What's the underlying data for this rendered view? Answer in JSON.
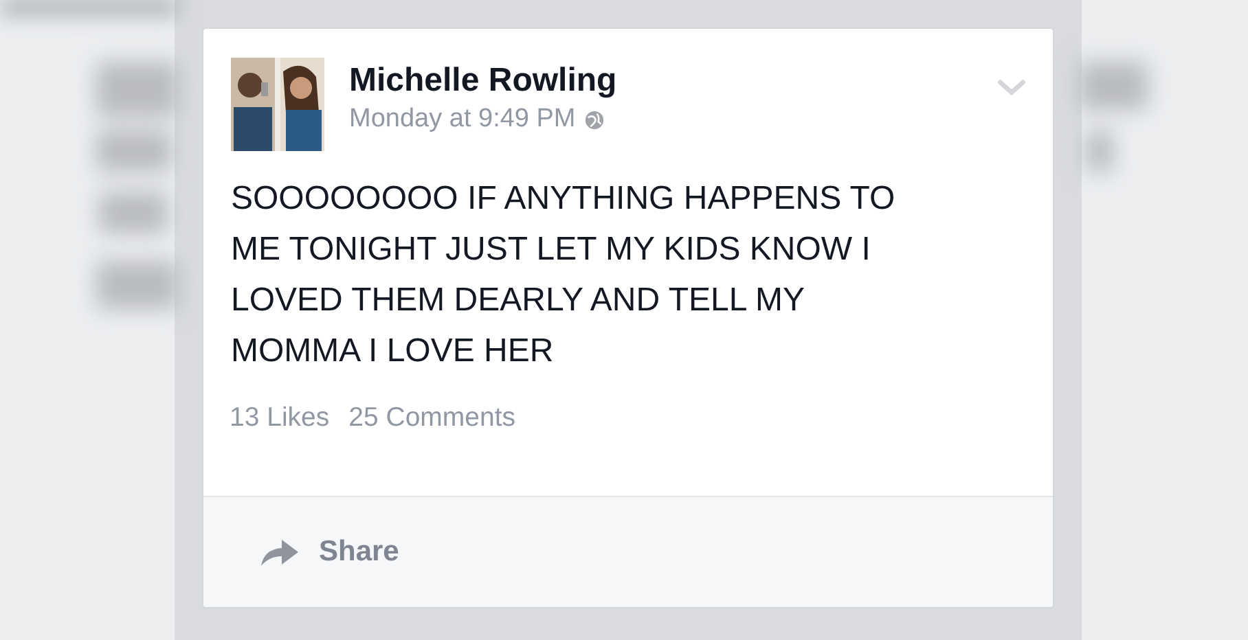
{
  "post": {
    "author": "Michelle Rowling",
    "timestamp": "Monday at 9:49 PM",
    "text_lines": [
      "SOOOOOOOO IF ANYTHING HAPPENS TO",
      "ME TONIGHT JUST LET MY KIDS KNOW I",
      "LOVED THEM DEARLY AND TELL MY",
      "MOMMA I LOVE HER"
    ],
    "likes": "13 Likes",
    "comments": "25 Comments",
    "actions": [
      "Share"
    ]
  }
}
